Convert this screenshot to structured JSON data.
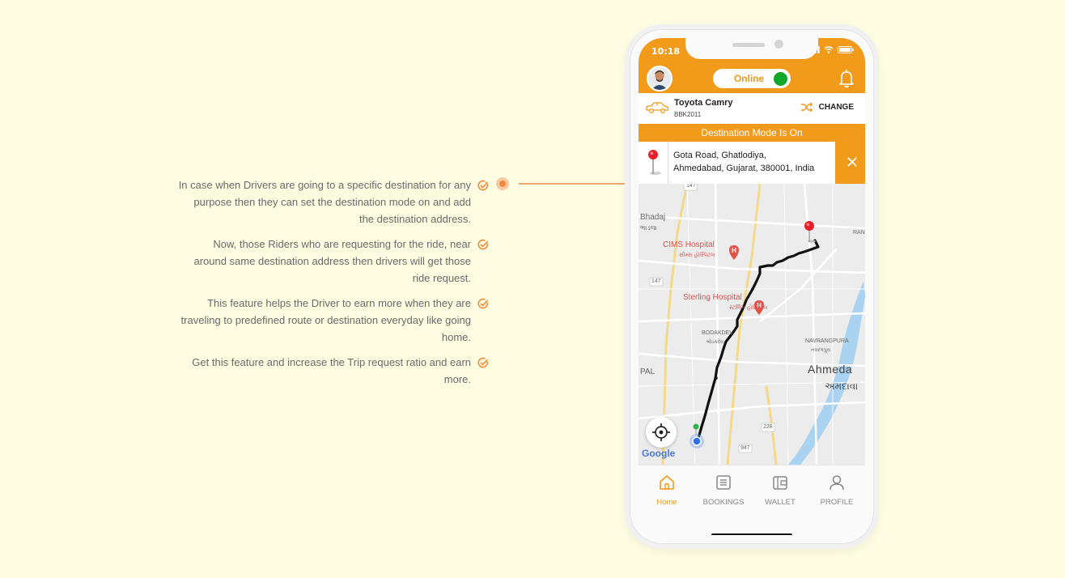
{
  "features": [
    {
      "text": "In case when Drivers are going to a specific destination for any purpose then they can set the destination mode on and add the destination address."
    },
    {
      "text": "Now, those Riders who are requesting for the ride, near around same destination address then drivers will get those ride request."
    },
    {
      "text": "This feature helps the Driver to earn more when they are traveling to predefined route or destination everyday like going home."
    },
    {
      "text": "Get this feature and increase the Trip request ratio and earn more."
    }
  ],
  "status_bar": {
    "time": "10:18"
  },
  "header": {
    "status_label": "Online"
  },
  "vehicle": {
    "name": "Toyota Camry",
    "plate": "BBK2011",
    "change_label": "CHANGE"
  },
  "destination": {
    "banner": "Destination Mode Is On",
    "address_line1": "Gota Road, Ghatlodiya,",
    "address_line2": "Ahmedabad, Gujarat, 380001, India"
  },
  "map": {
    "labels": {
      "bhadaj": "Bhadaj",
      "bhadaj_gu": "ભાડજ",
      "cims": "CIMS Hospital",
      "cims_gu": "સીમ્સ હોસ્પિટલ",
      "sterling": "Sterling Hospital",
      "sterling_gu": "સ્ટર્લિંગ હોસ્પિટલ",
      "bodakdev": "BODAKDEV",
      "bodakdev_gu": "બોડકદેવ",
      "navrangpura": "NAVRANGPURA",
      "navrangpura_gu": "નવરંગપુરા",
      "ahmedabad": "Ahmeda",
      "ahmedabad_gu": "અમદાવા",
      "pal": "PAL",
      "ran": "RAN",
      "road_147a": "147",
      "road_147b": "147",
      "road_228": "228",
      "road_947": "947",
      "google": "Google"
    }
  },
  "tabs": [
    {
      "label": "Home",
      "icon": "home-icon",
      "active": true
    },
    {
      "label": "BOOKINGS",
      "icon": "list-icon",
      "active": false
    },
    {
      "label": "WALLET",
      "icon": "wallet-icon",
      "active": false
    },
    {
      "label": "PROFILE",
      "icon": "user-icon",
      "active": false
    }
  ],
  "colors": {
    "brand": "#f29b1b",
    "online": "#11a82c",
    "background": "#fefde2",
    "route": "#111111"
  }
}
